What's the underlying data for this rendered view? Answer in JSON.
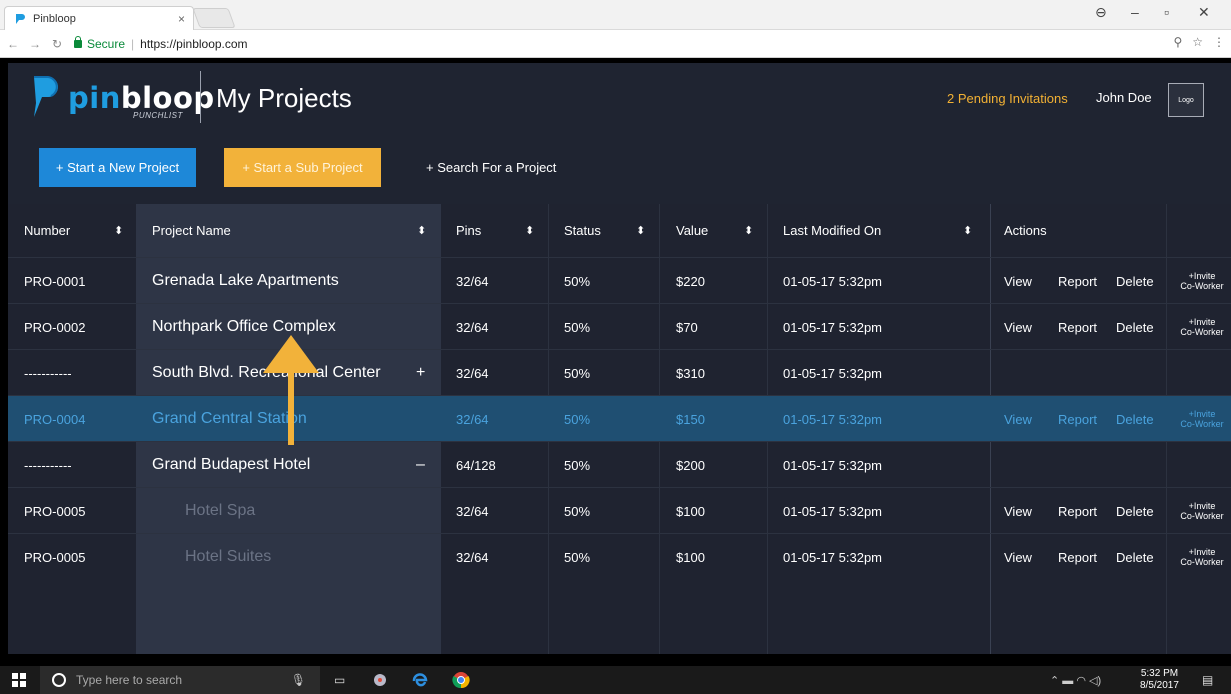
{
  "browser": {
    "tab_title": "Pinbloop",
    "tab_close": "×",
    "url_secure": "Secure",
    "url": "https://pinbloop.com"
  },
  "header": {
    "logo_pin": "pin",
    "logo_bloop": "bloop",
    "logo_sub": "PUNCHLIST",
    "title": "My Projects",
    "pending": "2 Pending Invitations",
    "user": "John Doe",
    "logo_box": "Logo"
  },
  "actions": {
    "new_project": "+ Start a New Project",
    "sub_project": "+ Start a Sub Project",
    "search_project": "+ Search For a Project"
  },
  "table": {
    "headers": {
      "number": "Number",
      "name": "Project Name",
      "pins": "Pins",
      "status": "Status",
      "value": "Value",
      "modified": "Last Modified On",
      "actions": "Actions"
    },
    "sort_glyph": "⬍",
    "rows": [
      {
        "number": "PRO-0001",
        "name": "Grenada Lake Apartments",
        "pins": "32/64",
        "status": "50%",
        "value": "$220",
        "modified": "01-05-17  5:32pm",
        "toggle": "",
        "view": "View",
        "report": "Report",
        "delete": "Delete",
        "invite1": "+Invite",
        "invite2": "Co-Worker"
      },
      {
        "number": "PRO-0002",
        "name": "Northpark Office Complex",
        "pins": "32/64",
        "status": "50%",
        "value": "$70",
        "modified": "01-05-17  5:32pm",
        "toggle": "",
        "view": "View",
        "report": "Report",
        "delete": "Delete",
        "invite1": "+Invite",
        "invite2": "Co-Worker"
      },
      {
        "number": "-----------",
        "name": "South Blvd. Recreational Center",
        "pins": "32/64",
        "status": "50%",
        "value": "$310",
        "modified": "01-05-17  5:32pm",
        "toggle": "+",
        "view": "",
        "report": "",
        "delete": "",
        "invite1": "",
        "invite2": ""
      },
      {
        "number": "PRO-0004",
        "name": "Grand Central Station",
        "pins": "32/64",
        "status": "50%",
        "value": "$150",
        "modified": "01-05-17  5:32pm",
        "toggle": "",
        "view": "View",
        "report": "Report",
        "delete": "Delete",
        "invite1": "+Invite",
        "invite2": "Co-Worker"
      },
      {
        "number": "-----------",
        "name": "Grand Budapest Hotel",
        "pins": "64/128",
        "status": "50%",
        "value": "$200",
        "modified": "01-05-17  5:32pm",
        "toggle": "–",
        "view": "",
        "report": "",
        "delete": "",
        "invite1": "",
        "invite2": ""
      },
      {
        "number": "PRO-0005",
        "name": "Hotel Spa",
        "pins": "32/64",
        "status": "50%",
        "value": "$100",
        "modified": "01-05-17  5:32pm",
        "toggle": "",
        "view": "View",
        "report": "Report",
        "delete": "Delete",
        "invite1": "+Invite",
        "invite2": "Co-Worker"
      },
      {
        "number": "PRO-0005",
        "name": "Hotel Suites",
        "pins": "32/64",
        "status": "50%",
        "value": "$100",
        "modified": "01-05-17  5:32pm",
        "toggle": "",
        "view": "View",
        "report": "Report",
        "delete": "Delete",
        "invite1": "+Invite",
        "invite2": "Co-Worker"
      }
    ]
  },
  "taskbar": {
    "search_placeholder": "Type here to search",
    "time": "5:32 PM",
    "date": "8/5/2017"
  },
  "colors": {
    "accent_blue": "#1e88d8",
    "accent_orange": "#f2b23a",
    "bg": "#1e2330",
    "highlight": "#1f4f72"
  }
}
